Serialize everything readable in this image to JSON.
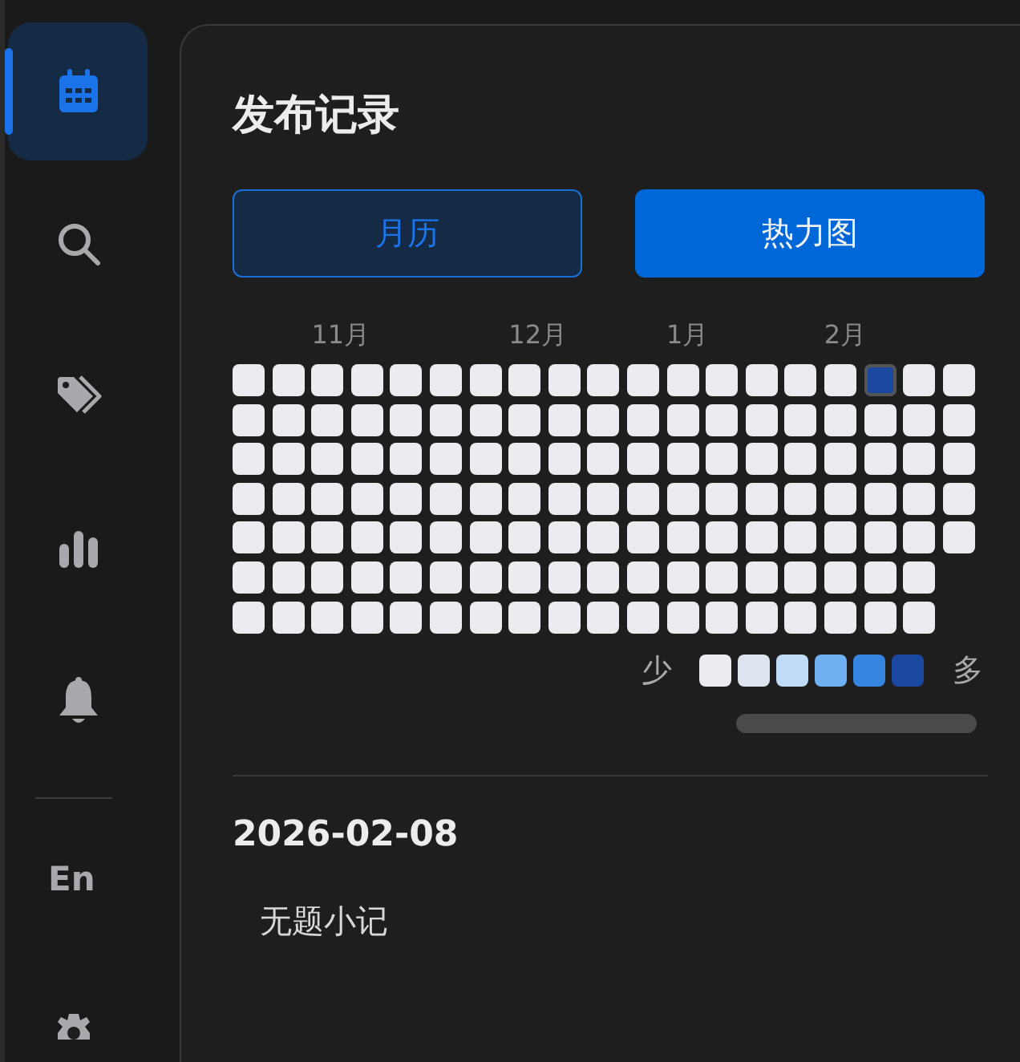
{
  "sidebar": {
    "items": [
      {
        "selected": true
      },
      {
        "selected": false
      },
      {
        "selected": false
      },
      {
        "selected": false
      },
      {
        "selected": false
      }
    ],
    "language": "En"
  },
  "panel": {
    "title": "发布记录",
    "views": [
      {
        "label": "月历",
        "selected": false
      },
      {
        "label": "热力图",
        "selected": true
      }
    ],
    "heatmap": {
      "weeks": [
        {
          "days": [
            {
              "color": "#ebecf0",
              "selected": false
            },
            {
              "color": "#ebecf0",
              "selected": false
            },
            {
              "color": "#ebecf0",
              "selected": false
            },
            {
              "color": "#ebecf0",
              "selected": false
            },
            {
              "color": "#ebecf0",
              "selected": false
            },
            {
              "color": "#ebecf0",
              "selected": false
            },
            {
              "color": "#ebecf0",
              "selected": false
            }
          ]
        },
        {
          "days": [
            {
              "color": "#ebecf0",
              "selected": false
            },
            {
              "color": "#ebecf0",
              "selected": false
            },
            {
              "color": "#ebecf0",
              "selected": false
            },
            {
              "color": "#ebecf0",
              "selected": false
            },
            {
              "color": "#ebecf0",
              "selected": false
            },
            {
              "color": "#ebecf0",
              "selected": false
            },
            {
              "color": "#ebecf0",
              "selected": false
            }
          ]
        },
        {
          "month": "11月",
          "days": [
            {
              "color": "#ebecf0",
              "selected": false
            },
            {
              "color": "#ebecf0",
              "selected": false
            },
            {
              "color": "#ebecf0",
              "selected": false
            },
            {
              "color": "#ebecf0",
              "selected": false
            },
            {
              "color": "#ebecf0",
              "selected": false
            },
            {
              "color": "#ebecf0",
              "selected": false
            },
            {
              "color": "#ebecf0",
              "selected": false
            }
          ]
        },
        {
          "days": [
            {
              "color": "#ebecf0",
              "selected": false
            },
            {
              "color": "#ebecf0",
              "selected": false
            },
            {
              "color": "#ebecf0",
              "selected": false
            },
            {
              "color": "#ebecf0",
              "selected": false
            },
            {
              "color": "#ebecf0",
              "selected": false
            },
            {
              "color": "#ebecf0",
              "selected": false
            },
            {
              "color": "#ebecf0",
              "selected": false
            }
          ]
        },
        {
          "days": [
            {
              "color": "#ebecf0",
              "selected": false
            },
            {
              "color": "#ebecf0",
              "selected": false
            },
            {
              "color": "#ebecf0",
              "selected": false
            },
            {
              "color": "#ebecf0",
              "selected": false
            },
            {
              "color": "#ebecf0",
              "selected": false
            },
            {
              "color": "#ebecf0",
              "selected": false
            },
            {
              "color": "#ebecf0",
              "selected": false
            }
          ]
        },
        {
          "days": [
            {
              "color": "#ebecf0",
              "selected": false
            },
            {
              "color": "#ebecf0",
              "selected": false
            },
            {
              "color": "#ebecf0",
              "selected": false
            },
            {
              "color": "#ebecf0",
              "selected": false
            },
            {
              "color": "#ebecf0",
              "selected": false
            },
            {
              "color": "#ebecf0",
              "selected": false
            },
            {
              "color": "#ebecf0",
              "selected": false
            }
          ]
        },
        {
          "days": [
            {
              "color": "#ebecf0",
              "selected": false
            },
            {
              "color": "#ebecf0",
              "selected": false
            },
            {
              "color": "#ebecf0",
              "selected": false
            },
            {
              "color": "#ebecf0",
              "selected": false
            },
            {
              "color": "#ebecf0",
              "selected": false
            },
            {
              "color": "#ebecf0",
              "selected": false
            },
            {
              "color": "#ebecf0",
              "selected": false
            }
          ]
        },
        {
          "month": "12月",
          "days": [
            {
              "color": "#ebecf0",
              "selected": false
            },
            {
              "color": "#ebecf0",
              "selected": false
            },
            {
              "color": "#ebecf0",
              "selected": false
            },
            {
              "color": "#ebecf0",
              "selected": false
            },
            {
              "color": "#ebecf0",
              "selected": false
            },
            {
              "color": "#ebecf0",
              "selected": false
            },
            {
              "color": "#ebecf0",
              "selected": false
            }
          ]
        },
        {
          "days": [
            {
              "color": "#ebecf0",
              "selected": false
            },
            {
              "color": "#ebecf0",
              "selected": false
            },
            {
              "color": "#ebecf0",
              "selected": false
            },
            {
              "color": "#ebecf0",
              "selected": false
            },
            {
              "color": "#ebecf0",
              "selected": false
            },
            {
              "color": "#ebecf0",
              "selected": false
            },
            {
              "color": "#ebecf0",
              "selected": false
            }
          ]
        },
        {
          "days": [
            {
              "color": "#ebecf0",
              "selected": false
            },
            {
              "color": "#ebecf0",
              "selected": false
            },
            {
              "color": "#ebecf0",
              "selected": false
            },
            {
              "color": "#ebecf0",
              "selected": false
            },
            {
              "color": "#ebecf0",
              "selected": false
            },
            {
              "color": "#ebecf0",
              "selected": false
            },
            {
              "color": "#ebecf0",
              "selected": false
            }
          ]
        },
        {
          "days": [
            {
              "color": "#ebecf0",
              "selected": false
            },
            {
              "color": "#ebecf0",
              "selected": false
            },
            {
              "color": "#ebecf0",
              "selected": false
            },
            {
              "color": "#ebecf0",
              "selected": false
            },
            {
              "color": "#ebecf0",
              "selected": false
            },
            {
              "color": "#ebecf0",
              "selected": false
            },
            {
              "color": "#ebecf0",
              "selected": false
            }
          ]
        },
        {
          "month": "1月",
          "days": [
            {
              "color": "#ebecf0",
              "selected": false
            },
            {
              "color": "#ebecf0",
              "selected": false
            },
            {
              "color": "#ebecf0",
              "selected": false
            },
            {
              "color": "#ebecf0",
              "selected": false
            },
            {
              "color": "#ebecf0",
              "selected": false
            },
            {
              "color": "#ebecf0",
              "selected": false
            },
            {
              "color": "#ebecf0",
              "selected": false
            }
          ]
        },
        {
          "days": [
            {
              "color": "#ebecf0",
              "selected": false
            },
            {
              "color": "#ebecf0",
              "selected": false
            },
            {
              "color": "#ebecf0",
              "selected": false
            },
            {
              "color": "#ebecf0",
              "selected": false
            },
            {
              "color": "#ebecf0",
              "selected": false
            },
            {
              "color": "#ebecf0",
              "selected": false
            },
            {
              "color": "#ebecf0",
              "selected": false
            }
          ]
        },
        {
          "days": [
            {
              "color": "#ebecf0",
              "selected": false
            },
            {
              "color": "#ebecf0",
              "selected": false
            },
            {
              "color": "#ebecf0",
              "selected": false
            },
            {
              "color": "#ebecf0",
              "selected": false
            },
            {
              "color": "#ebecf0",
              "selected": false
            },
            {
              "color": "#ebecf0",
              "selected": false
            },
            {
              "color": "#ebecf0",
              "selected": false
            }
          ]
        },
        {
          "days": [
            {
              "color": "#ebecf0",
              "selected": false
            },
            {
              "color": "#ebecf0",
              "selected": false
            },
            {
              "color": "#ebecf0",
              "selected": false
            },
            {
              "color": "#ebecf0",
              "selected": false
            },
            {
              "color": "#ebecf0",
              "selected": false
            },
            {
              "color": "#ebecf0",
              "selected": false
            },
            {
              "color": "#ebecf0",
              "selected": false
            }
          ]
        },
        {
          "month": "2月",
          "days": [
            {
              "color": "#ebecf0",
              "selected": false
            },
            {
              "color": "#ebecf0",
              "selected": false
            },
            {
              "color": "#ebecf0",
              "selected": false
            },
            {
              "color": "#ebecf0",
              "selected": false
            },
            {
              "color": "#ebecf0",
              "selected": false
            },
            {
              "color": "#ebecf0",
              "selected": false
            },
            {
              "color": "#ebecf0",
              "selected": false
            }
          ]
        },
        {
          "days": [
            {
              "color": "#1a47a0",
              "selected": true
            },
            {
              "color": "#ebecf0",
              "selected": false
            },
            {
              "color": "#ebecf0",
              "selected": false
            },
            {
              "color": "#ebecf0",
              "selected": false
            },
            {
              "color": "#ebecf0",
              "selected": false
            },
            {
              "color": "#ebecf0",
              "selected": false
            },
            {
              "color": "#ebecf0",
              "selected": false
            }
          ]
        },
        {
          "days": [
            {
              "color": "#ebecf0",
              "selected": false
            },
            {
              "color": "#ebecf0",
              "selected": false
            },
            {
              "color": "#ebecf0",
              "selected": false
            },
            {
              "color": "#ebecf0",
              "selected": false
            },
            {
              "color": "#ebecf0",
              "selected": false
            },
            {
              "color": "#ebecf0",
              "selected": false
            },
            {
              "color": "#ebecf0",
              "selected": false
            }
          ]
        },
        {
          "days": [
            {
              "color": "#ebecf0",
              "selected": false
            },
            {
              "color": "#ebecf0",
              "selected": false
            },
            {
              "color": "#ebecf0",
              "selected": false
            },
            {
              "color": "#ebecf0",
              "selected": false
            },
            {
              "color": "#ebecf0",
              "selected": false
            }
          ]
        }
      ],
      "legend": {
        "low": "少",
        "high": "多",
        "swatches": [
          {
            "color": "#ebecf0"
          },
          {
            "color": "#dde4ef"
          },
          {
            "color": "#c0dcf8"
          },
          {
            "color": "#6eb0f0"
          },
          {
            "color": "#3584e0"
          },
          {
            "color": "#1a47a0"
          }
        ]
      }
    },
    "date": "2026-02-08",
    "entries": [
      "无题小记"
    ]
  }
}
